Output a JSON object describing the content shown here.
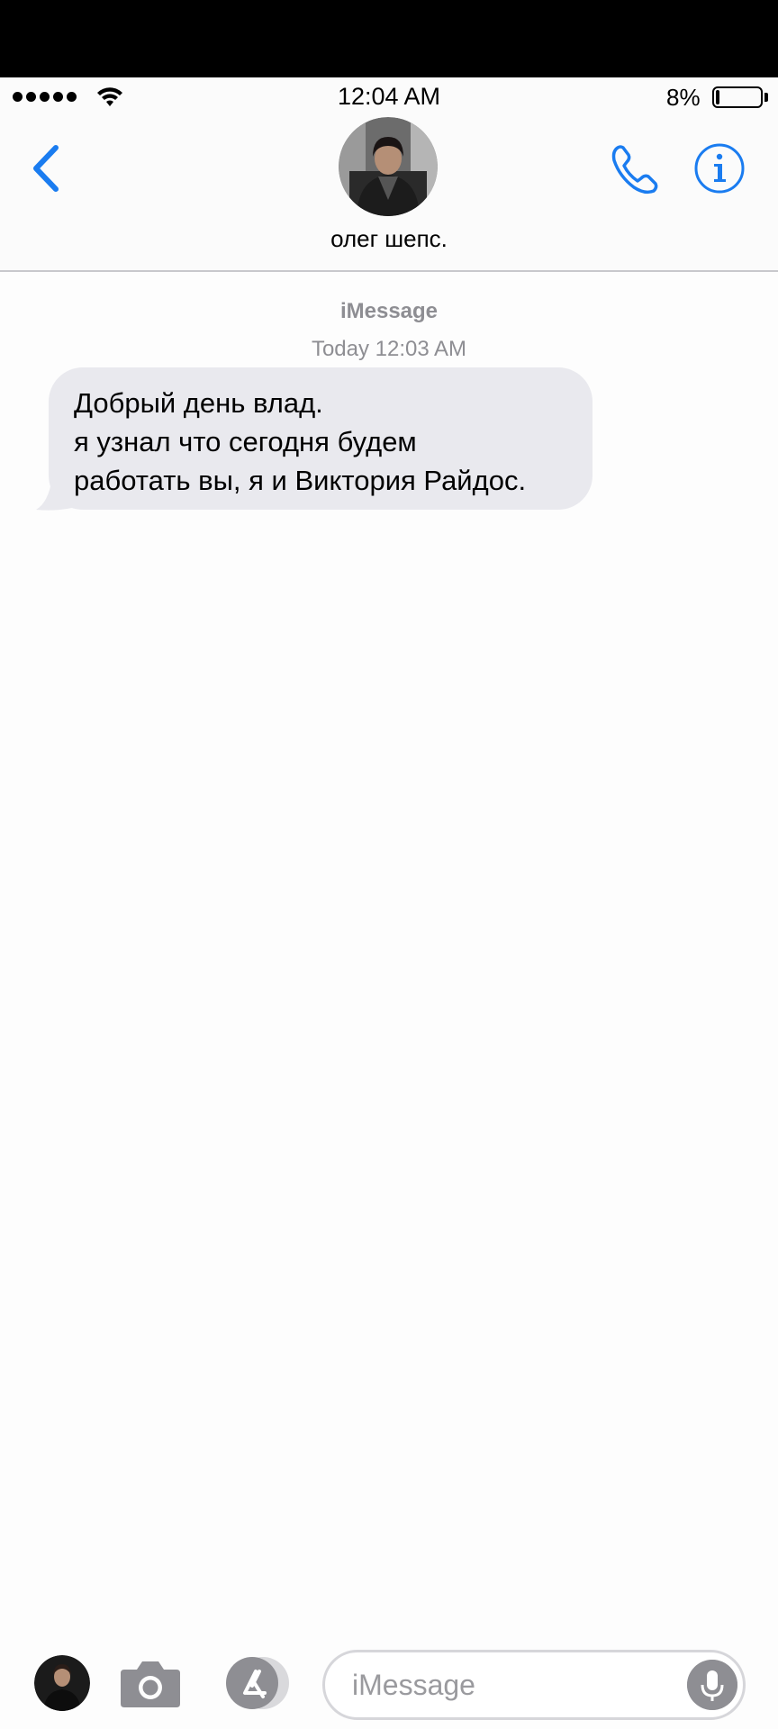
{
  "status_bar": {
    "time": "12:04 AM",
    "battery_percent": "8%",
    "battery_level": 0.08,
    "signal_dots": 5
  },
  "header": {
    "contact_name": "олег шепс.",
    "back_icon": "chevron-left-icon",
    "call_icon": "phone-icon",
    "info_icon": "info-icon"
  },
  "conversation": {
    "service": "iMessage",
    "timestamp": "Today 12:03 AM",
    "messages": [
      {
        "direction": "incoming",
        "text": "Добрый день влад.\nя узнал что сегодня будем\nработать вы, я и Виктория Райдос."
      }
    ]
  },
  "input_bar": {
    "placeholder": "iMessage",
    "camera_icon": "camera-icon",
    "apps_icon": "app-store-icon",
    "mic_icon": "microphone-icon"
  },
  "colors": {
    "accent": "#1a7cf0",
    "bubble_incoming": "#e9e9ee",
    "secondary_text": "#8e8e93"
  }
}
